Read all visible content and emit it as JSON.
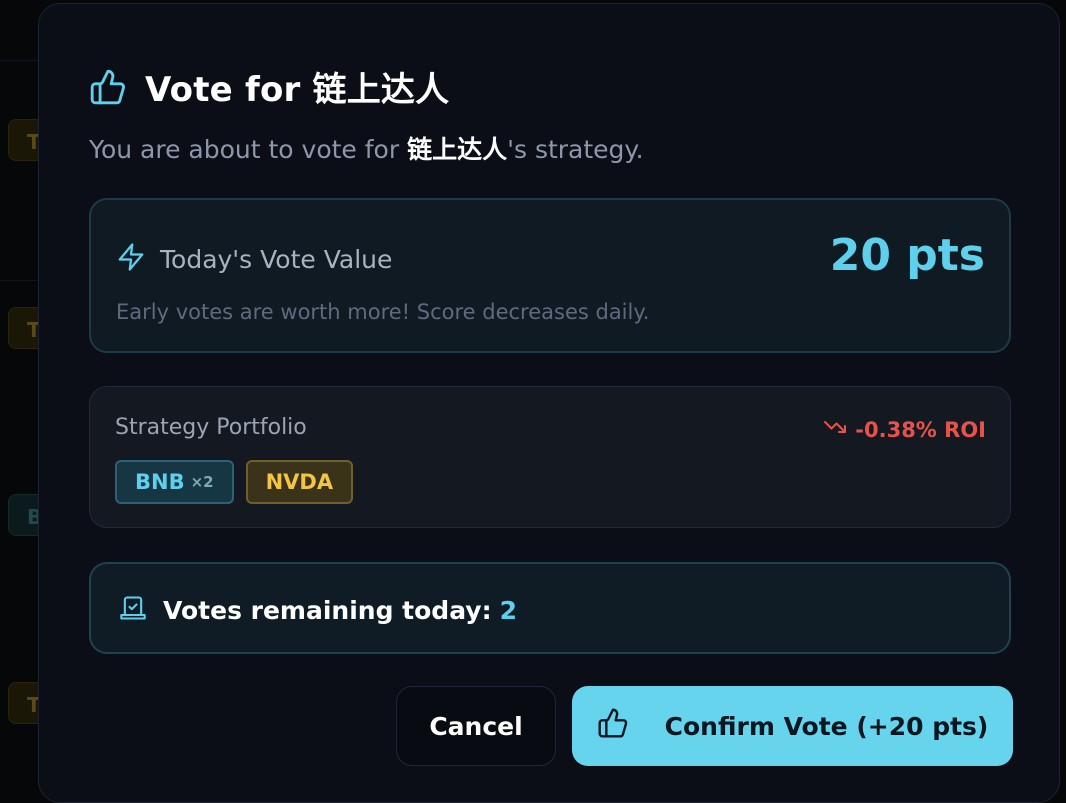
{
  "modal": {
    "title": "Vote for 链上达人",
    "title_icon": "thumbs-up-icon",
    "subtitle_pre": "You are about to vote for ",
    "subtitle_name": "链上达人",
    "subtitle_post": "'s strategy."
  },
  "vote_value": {
    "icon": "lightning-icon",
    "label": "Today's Vote Value",
    "amount": "20 pts",
    "note": "Early votes are worth more! Score decreases daily."
  },
  "portfolio": {
    "label": "Strategy Portfolio",
    "roi_icon": "trend-down-icon",
    "roi": "-0.38% ROI",
    "assets": [
      {
        "symbol": "BNB",
        "multiplier": "×2"
      },
      {
        "symbol": "NVDA",
        "multiplier": ""
      }
    ]
  },
  "votes": {
    "icon": "ballot-box-icon",
    "label": "Votes remaining today:",
    "count": "2"
  },
  "actions": {
    "cancel_label": "Cancel",
    "confirm_label": "Confirm Vote (+20 pts)"
  },
  "background": {
    "chips": [
      "T",
      "T",
      "B",
      "T"
    ]
  },
  "colors": {
    "accent": "#5ed0ec",
    "negative": "#e5534b",
    "nvda": "#f2c542",
    "modal_bg": "#0b0e16"
  }
}
